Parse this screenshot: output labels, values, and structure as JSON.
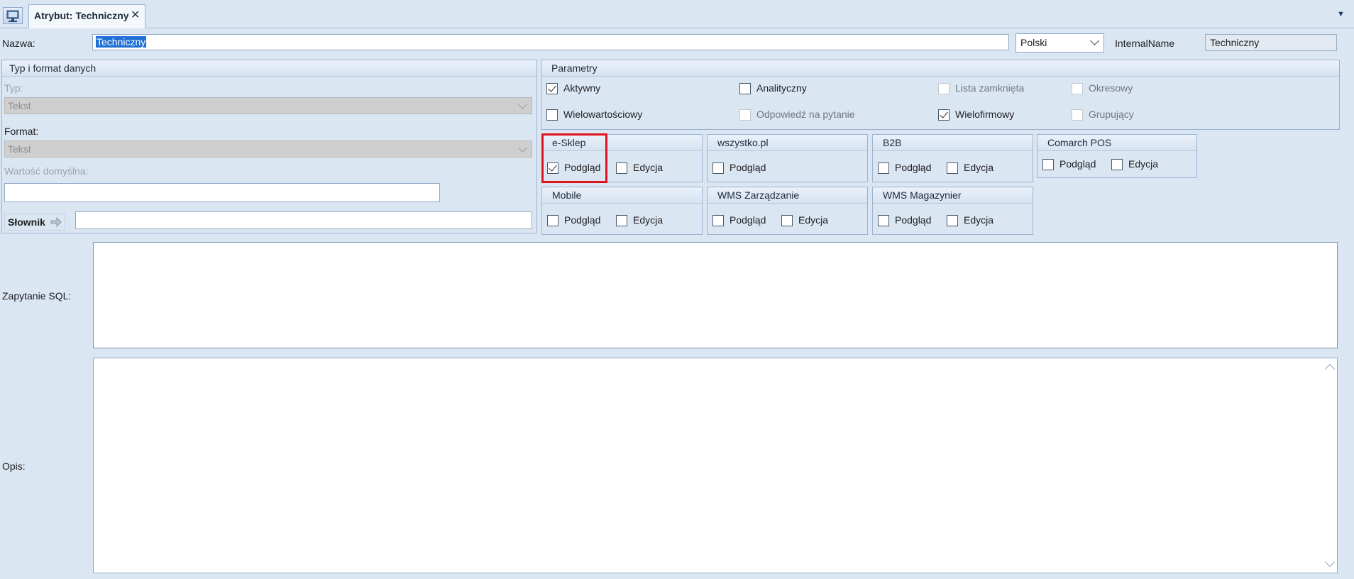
{
  "tab": {
    "title": "Atrybut: Techniczny",
    "close": "✕"
  },
  "header": {
    "name_label": "Nazwa:",
    "name_value": "Techniczny",
    "language": "Polski",
    "internal_name_label": "InternalName",
    "internal_name_value": "Techniczny"
  },
  "type_group": {
    "title": "Typ i format danych",
    "type_label": "Typ:",
    "type_value": "Tekst",
    "format_label": "Format:",
    "format_value": "Tekst",
    "default_label": "Wartość domyślna:",
    "default_value": "",
    "dictionary_button": "Słownik",
    "dictionary_value": ""
  },
  "params": {
    "title": "Parametry",
    "items": [
      {
        "label": "Aktywny",
        "checked": true,
        "enabled": true
      },
      {
        "label": "Analityczny",
        "checked": false,
        "enabled": true
      },
      {
        "label": "Lista zamknięta",
        "checked": false,
        "enabled": false
      },
      {
        "label": "Okresowy",
        "checked": false,
        "enabled": false
      },
      {
        "label": "Wielowartościowy",
        "checked": false,
        "enabled": true
      },
      {
        "label": "Odpowiedź na pytanie",
        "checked": false,
        "enabled": false
      },
      {
        "label": "Wielofirmowy",
        "checked": true,
        "enabled": true
      },
      {
        "label": "Grupujący",
        "checked": false,
        "enabled": false
      }
    ]
  },
  "channels": [
    {
      "title": "e-Sklep",
      "preview": "Podgląd",
      "preview_checked": true,
      "edit": "Edycja",
      "edit_checked": false,
      "highlighted": true
    },
    {
      "title": "wszystko.pl",
      "preview": "Podgląd",
      "preview_checked": false
    },
    {
      "title": "B2B",
      "preview": "Podgląd",
      "preview_checked": false,
      "edit": "Edycja",
      "edit_checked": false
    },
    {
      "title": "Comarch POS",
      "preview": "Podgląd",
      "preview_checked": false,
      "edit": "Edycja",
      "edit_checked": false
    },
    {
      "title": "Mobile",
      "preview": "Podgląd",
      "preview_checked": false,
      "edit": "Edycja",
      "edit_checked": false
    },
    {
      "title": "WMS Zarządzanie",
      "preview": "Podgląd",
      "preview_checked": false,
      "edit": "Edycja",
      "edit_checked": false
    },
    {
      "title": "WMS Magazynier",
      "preview": "Podgląd",
      "preview_checked": false,
      "edit": "Edycja",
      "edit_checked": false
    }
  ],
  "sql": {
    "label": "Zapytanie SQL:",
    "value": ""
  },
  "description": {
    "label": "Opis:",
    "value": ""
  },
  "colors": {
    "accent": "#1f6fd6",
    "highlight": "#e0141e",
    "background": "#dbe6f3"
  }
}
